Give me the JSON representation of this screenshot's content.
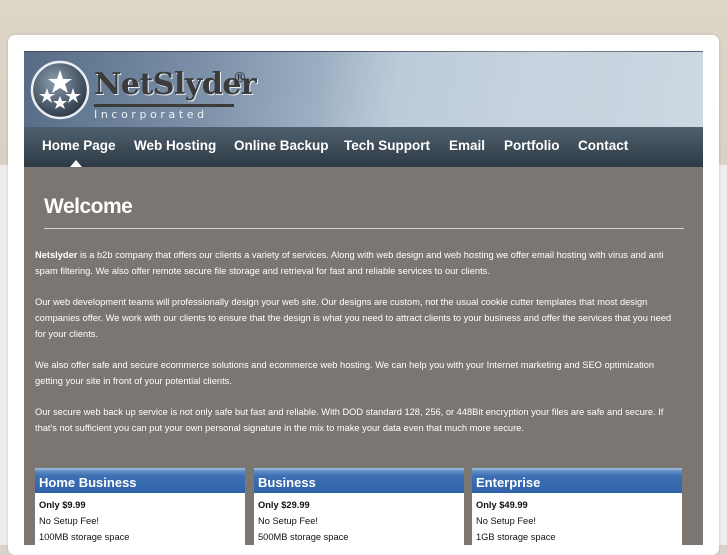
{
  "brand": {
    "name": "NetSlyder",
    "registered": "®",
    "tagline": "Incorporated",
    "logo_icon": "stars-circle-icon"
  },
  "nav": {
    "items": [
      {
        "label": "Home Page",
        "active": true
      },
      {
        "label": "Web Hosting"
      },
      {
        "label": "Online Backup"
      },
      {
        "label": "Tech Support"
      },
      {
        "label": "Email"
      },
      {
        "label": "Portfolio"
      },
      {
        "label": "Contact"
      }
    ]
  },
  "page": {
    "title": "Welcome",
    "intro_bold": "Netslyder",
    "intro_rest": " is a b2b company that offers our clients a variety of services.  Along with web design and web hosting we offer email hosting with virus and anti spam filtering.  We also offer remote secure file storage and retrieval for fast and reliable services to our clients.",
    "para2": "Our web development teams will professionally design your web site. Our designs are custom, not the usual cookie cutter templates that most design companies offer.  We work with our clients to ensure that the design is what you need to attract clients to your business and offer the services that you need for your clients.",
    "para3": "We also offer safe and secure ecommerce solutions and ecommerce web hosting. We can help you with your Internet marketing and SEO optimization getting your site in front of your potential clients.",
    "para4": "Our secure web back up service is not only safe but fast and reliable. With DOD standard 128, 256, or 448Bit encryption your files are safe and secure. If that's not sufficient you can put your own personal signature in the mix to make your data even that much more secure."
  },
  "plans": [
    {
      "name": "Home Business",
      "price": "Only $9.99",
      "setup": "No Setup Fee!",
      "storage": "100MB storage space"
    },
    {
      "name": "Business",
      "price": "Only $29.99",
      "setup": "No Setup Fee!",
      "storage": "500MB storage space"
    },
    {
      "name": "Enterprise",
      "price": "Only $49.99",
      "setup": "No Setup Fee!",
      "storage": "1GB storage space"
    }
  ],
  "colors": {
    "page_bg": "#7c7672",
    "nav_bg": "#2d3a44",
    "plan_header": "#2f62a8"
  }
}
